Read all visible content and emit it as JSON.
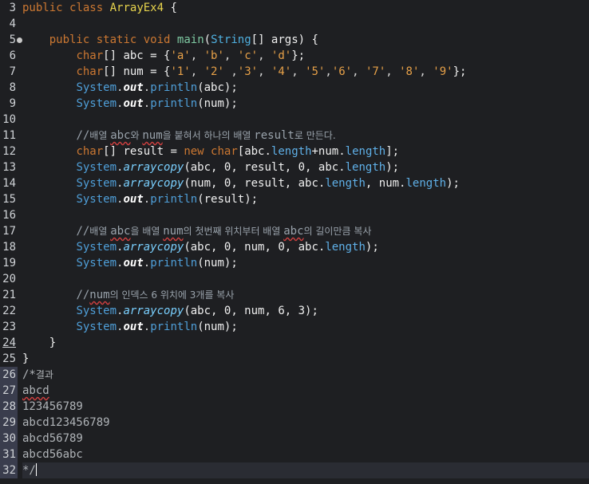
{
  "editor": {
    "line_numbers": [
      "3",
      "4",
      "5",
      "6",
      "7",
      "8",
      "9",
      "10",
      "11",
      "12",
      "13",
      "14",
      "15",
      "16",
      "17",
      "18",
      "19",
      "20",
      "21",
      "22",
      "23",
      "24",
      "25",
      "26",
      "27",
      "28",
      "29",
      "30",
      "31",
      "32"
    ],
    "code": {
      "l3_kw": "public",
      "l3_kw2": "class",
      "l3_cls": "ArrayEx4",
      "l3_rest": " {",
      "l5_kw": "public",
      "l5_kw2": "static",
      "l5_kw3": "void",
      "l5_fn": "main",
      "l5_p1": "(",
      "l5_type": "String",
      "l5_rest": "[] args) {",
      "l6_kw": "char",
      "l6_mid": "[] abc = {",
      "l6_s1": "'a'",
      "l6_s2": "'b'",
      "l6_s3": "'c'",
      "l6_s4": "'d'",
      "l6_end": "};",
      "l7_kw": "char",
      "l7_mid": "[] num = {",
      "l7_s1": "'1'",
      "l7_s2": "'2'",
      "l7_s3": "'3'",
      "l7_s4": "'4'",
      "l7_s5": "'5'",
      "l7_s6": "'6'",
      "l7_s7": "'7'",
      "l7_s8": "'8'",
      "l7_s9": "'9'",
      "l7_end": "};",
      "sys": "System",
      "out": "out",
      "println": "println",
      "arraycopy": "arraycopy",
      "l8_arg": "(abc);",
      "l9_arg": "(num);",
      "l11_c1": "//",
      "l11_k1": "배열 ",
      "l11_abc": "abc",
      "l11_k2": "와 ",
      "l11_num": "num",
      "l11_k3": "을 붙혀서 하나의 배열 ",
      "l11_res": "result",
      "l11_k4": "로 만든다.",
      "l12_kw": "char",
      "l12_mid": "[] result = ",
      "l12_new": "new",
      "l12_kw2": "char",
      "l12_a": "[abc.",
      "l12_len1": "length",
      "l12_b": "+num.",
      "l12_len2": "length",
      "l12_c": "];",
      "l13_args": "(abc, 0, result, 0, abc.",
      "l13_len": "length",
      "l13_end": ");",
      "l14_args": "(num, 0, result, abc.",
      "l14_len1": "length",
      "l14_mid": ", num.",
      "l14_len2": "length",
      "l14_end": ");",
      "l15_arg": "(result);",
      "l17_c1": "//",
      "l17_k1": "배열 ",
      "l17_abc": "abc",
      "l17_k2": "을 배열 ",
      "l17_num": "num",
      "l17_k3": "의 첫번째 위치부터 배열 ",
      "l17_abc2": "abc",
      "l17_k4": "의 길이만큼 복사",
      "l18_args": "(abc, 0, num, 0, abc.",
      "l18_len": "length",
      "l18_end": ");",
      "l19_arg": "(num);",
      "l21_c1": "//",
      "l21_num": "num",
      "l21_k1": "의 인덱스 6 위치에 3개를 복사",
      "l22_args": "(abc, 0, num, 6, 3);",
      "l23_arg": "(num);",
      "l24": "}",
      "l25": "}",
      "l26_c": "/*",
      "l26_k": "결과",
      "l27": "abcd",
      "l28": "123456789",
      "l29": "abcd123456789",
      "l30": "abcd56789",
      "l31": "abcd56abc",
      "l32": "*/"
    }
  }
}
